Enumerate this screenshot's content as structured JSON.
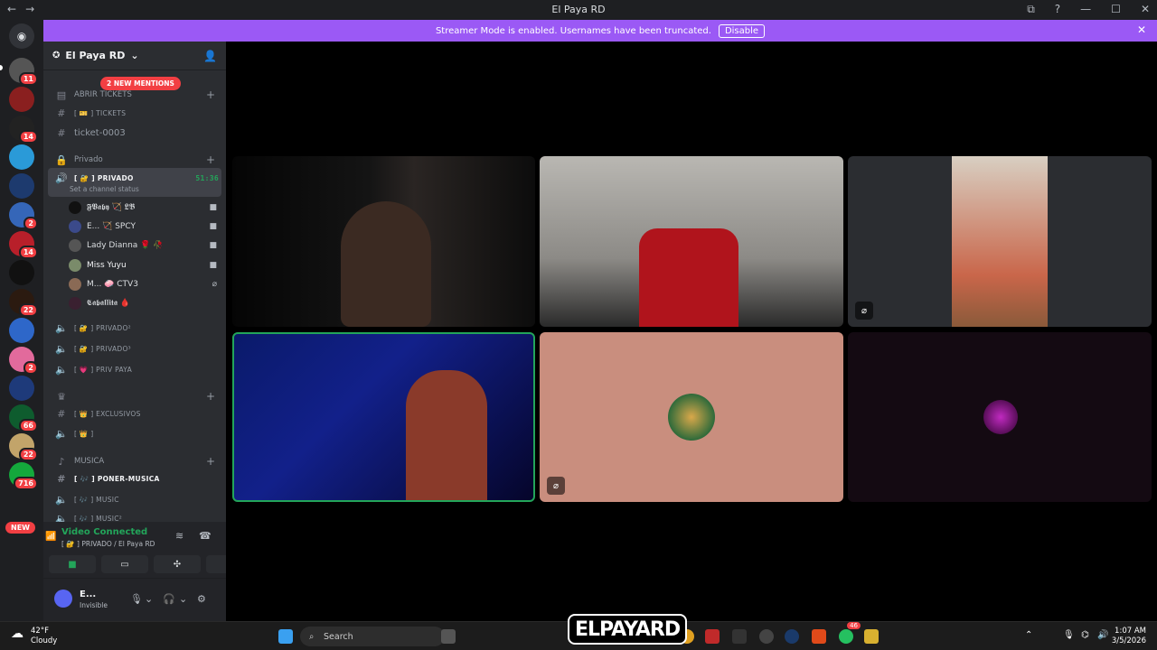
{
  "window": {
    "title": "El Paya RD",
    "back": "←",
    "forward": "→",
    "minimize": "—",
    "maximize": "☐",
    "close": "✕"
  },
  "banner": {
    "text": "Streamer Mode is enabled. Usernames have been truncated.",
    "disable_label": "Disable"
  },
  "servers": {
    "badges": [
      "11",
      "14",
      "2",
      "14",
      "22",
      "2",
      "66",
      "22",
      "716"
    ],
    "new_label": "NEW"
  },
  "guild": {
    "name": "El Paya RD"
  },
  "mentions_label": "2 NEW MENTIONS",
  "channels": {
    "cat_tickets": "ABRIR TICKETS",
    "tickets": "[ 🎫 ] TICKETS",
    "ticket_0003": "ticket-0003",
    "cat_privado": "Privado",
    "privado_active": "[ 🔐 ] PRIVADO",
    "privado_timer": "51:36",
    "channel_status": "Set a channel status",
    "privado2": "[ 🔐 ] PRIVADO²",
    "privado3": "[ 🔐 ] PRIVADO³",
    "priv_paya": "[ 💗 ] PRIV PAYA",
    "exclusivos": "[ 👑 ] EXCLUSIVOS",
    "crown": "[ 👑 ]",
    "cat_musica": "MUSICA",
    "poner_musica": "[ 🎶 ] PONER-MUSICA",
    "music": "[ 🎶 ] MUSIC",
    "music2": "[ 🎶 ] MUSIC²"
  },
  "voice_users": [
    {
      "name": "𝕱𝖁𝖆𝖇𝖞  🏹 𝕷𝕭",
      "color": "#111111"
    },
    {
      "name": "E...   🏹 SPCY",
      "color": "#3b4a8a"
    },
    {
      "name": "Lady Dianna 🌹 🥀",
      "color": "#555555"
    },
    {
      "name": "Miss Yuyu",
      "color": "#7a8b6a"
    },
    {
      "name": "M...  🧼 CTV3",
      "color": "#8a6a55"
    },
    {
      "name": "𝕮𝖆𝖇𝖆𝖑𝖑𝖎𝖙𝖆 🩸",
      "color": "#3a2030"
    }
  ],
  "voice_panel": {
    "status": "Video Connected",
    "location": "[ 🔐 ] PRIVADO / El Paya RD"
  },
  "user_panel": {
    "name": "E...",
    "status": "Invisible"
  },
  "taskbar": {
    "temp": "42°F",
    "condition": "Cloudy",
    "search": "Search",
    "time": "1:07 AM",
    "date": "3/5/2026",
    "notif": "46",
    "logo": "ELPAYARD"
  },
  "colors": {
    "accent": "#9b59f5",
    "online": "#23a55a",
    "danger": "#f23f43",
    "tile_pink": "#c98e7e"
  }
}
